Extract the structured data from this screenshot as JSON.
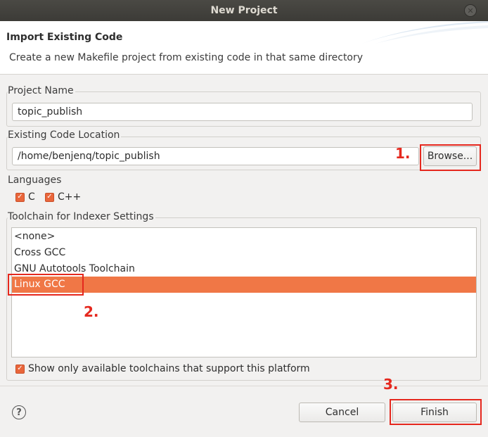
{
  "window": {
    "title": "New Project"
  },
  "banner": {
    "title": "Import Existing Code",
    "description": "Create a new Makefile project from existing code in that same directory"
  },
  "project_name": {
    "label": "Project Name",
    "value": "topic_publish"
  },
  "code_location": {
    "label": "Existing Code Location",
    "value": "/home/benjenq/topic_publish",
    "browse_label": "Browse..."
  },
  "languages": {
    "label": "Languages",
    "items": [
      {
        "label": "C",
        "checked": true
      },
      {
        "label": "C++",
        "checked": true
      }
    ]
  },
  "toolchain": {
    "label": "Toolchain for Indexer Settings",
    "items": [
      {
        "label": "<none>",
        "selected": false
      },
      {
        "label": "Cross GCC",
        "selected": false
      },
      {
        "label": "GNU Autotools Toolchain",
        "selected": false
      },
      {
        "label": "Linux GCC",
        "selected": true
      }
    ],
    "filter_label": "Show only available toolchains that support this platform",
    "filter_checked": true
  },
  "footer": {
    "cancel_label": "Cancel",
    "finish_label": "Finish"
  },
  "annotations": {
    "step1": "1.",
    "step2": "2.",
    "step3": "3."
  },
  "colors": {
    "accent": "#f07746",
    "annotation": "#e5281e",
    "titlebar": "#3c3b37"
  },
  "icons": {
    "close": "close-icon",
    "help": "help-icon",
    "check": "check-icon"
  }
}
